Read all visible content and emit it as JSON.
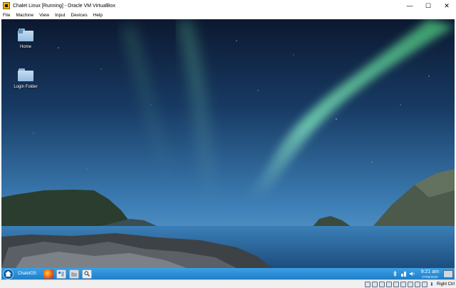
{
  "window": {
    "title": "Chalet Linux [Running] - Oracle VM VirtualBox",
    "controls": {
      "minimize": "—",
      "maximize": "☐",
      "close": "✕"
    }
  },
  "menubar": {
    "items": [
      "File",
      "Machine",
      "View",
      "Input",
      "Devices",
      "Help"
    ]
  },
  "desktop": {
    "icons": [
      {
        "label": "Home",
        "icon": "home-folder-icon"
      },
      {
        "label": "Login Folder",
        "icon": "folder-icon"
      }
    ]
  },
  "taskbar": {
    "os_label": "ChaletOS",
    "apps": [
      "firefox-icon",
      "file-manager-icon",
      "files-icon",
      "search-icon"
    ],
    "clock": {
      "time": "9:21 am",
      "date": "07/05/2020"
    },
    "tray_icons": [
      "bluetooth-icon",
      "network-icon",
      "volume-icon"
    ]
  },
  "statusbar": {
    "host_key": "Right Ctrl",
    "icons": [
      "hard-disk-icon",
      "optical-drive-icon",
      "audio-icon",
      "network-adapter-icon",
      "usb-icon",
      "shared-folders-icon",
      "display-icon",
      "recording-icon",
      "mouse-integration-icon",
      "keyboard-capture-icon"
    ]
  },
  "colors": {
    "taskbar": "#2a8fd9",
    "sky_top": "#0d1a33",
    "aurora": "#6ee0b0",
    "water": "#2f6ea3"
  }
}
